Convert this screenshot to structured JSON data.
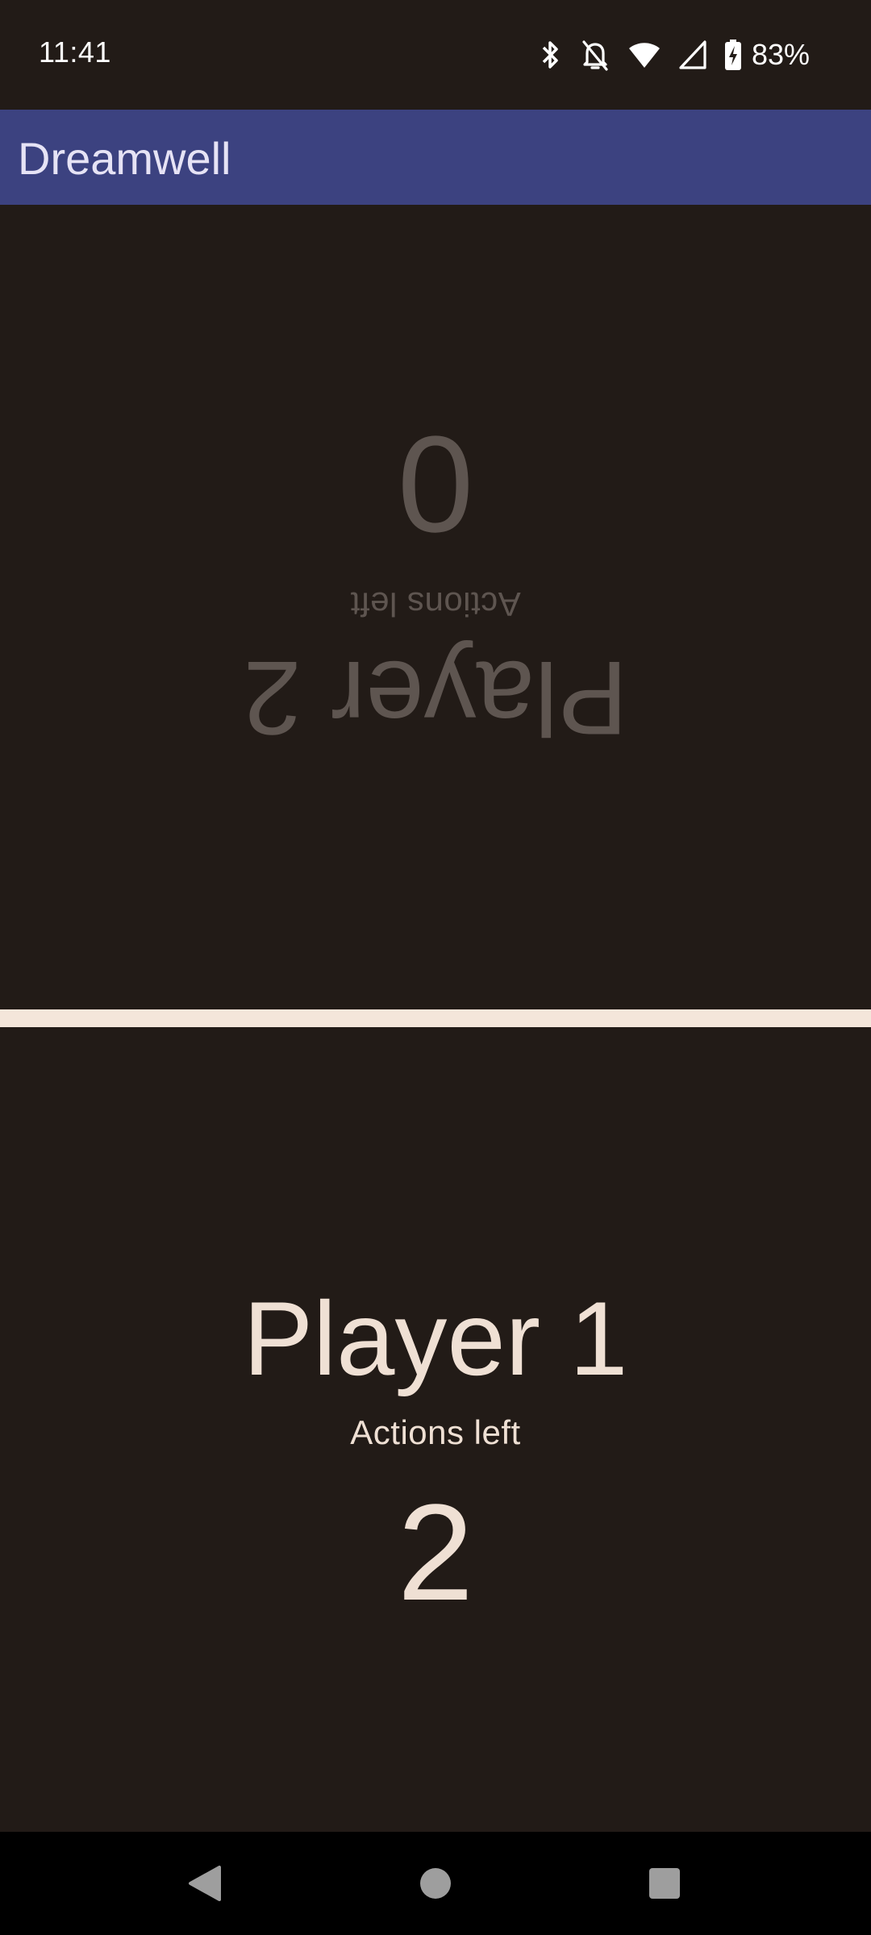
{
  "status_bar": {
    "time": "11:41",
    "battery_percent": "83%",
    "icons": [
      "bluetooth-icon",
      "bell-off-icon",
      "wifi-icon",
      "cell-signal-icon",
      "battery-charging-icon"
    ]
  },
  "app_bar": {
    "title": "Dreamwell",
    "color": "#3c4280"
  },
  "players": {
    "player2": {
      "name": "Player 2",
      "actions_label": "Actions left",
      "actions_left": "0",
      "inverted": true
    },
    "player1": {
      "name": "Player 1",
      "actions_label": "Actions left",
      "actions_left": "2",
      "inverted": false
    }
  },
  "colors": {
    "background": "#221b17",
    "active_text": "#efe0d4",
    "inactive_text": "#5e5550",
    "divider": "#f4e6da"
  },
  "nav_bar": {
    "buttons": [
      "back-icon",
      "home-icon",
      "recents-icon"
    ]
  }
}
